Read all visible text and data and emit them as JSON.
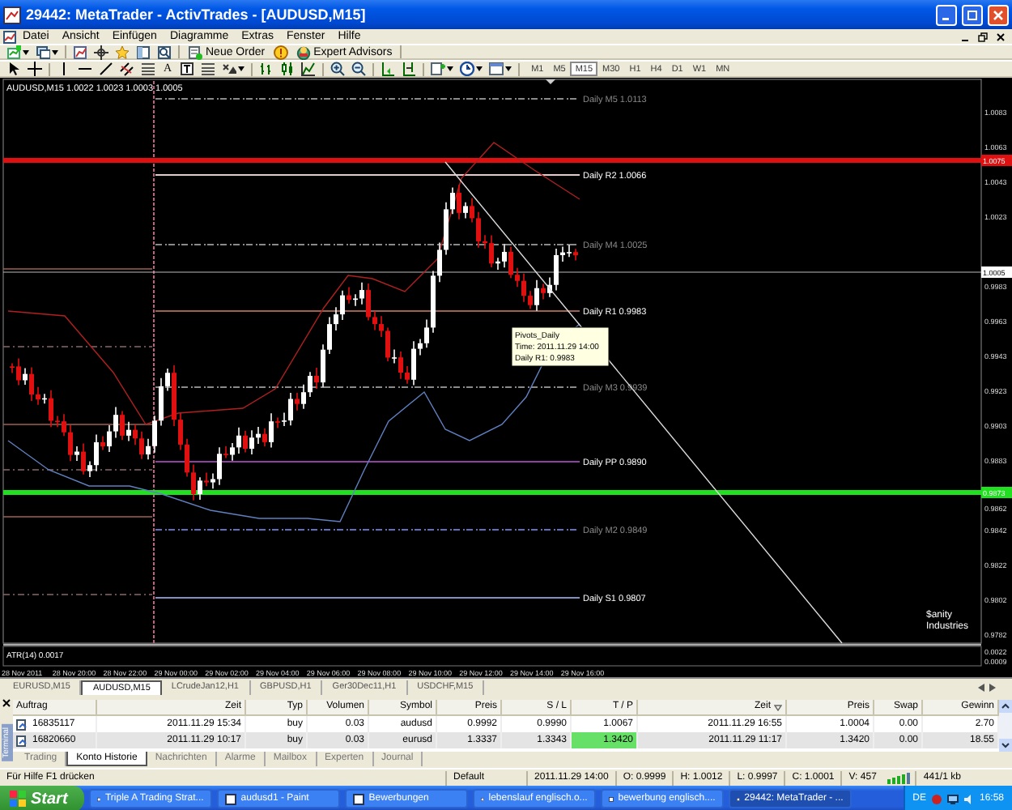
{
  "window": {
    "title": "29442: MetaTrader - ActivTrades - [AUDUSD,M15]"
  },
  "menu": [
    "Datei",
    "Ansicht",
    "Einfügen",
    "Diagramme",
    "Extras",
    "Fenster",
    "Hilfe"
  ],
  "toolbar": {
    "order_button": "Neue Order",
    "expert_button": "Expert Advisors",
    "text_tool": "A",
    "timeframes": [
      {
        "label": "M1",
        "selected": false
      },
      {
        "label": "M5",
        "selected": false
      },
      {
        "label": "M15",
        "selected": true
      },
      {
        "label": "M30",
        "selected": false
      },
      {
        "label": "H1",
        "selected": false
      },
      {
        "label": "H4",
        "selected": false
      },
      {
        "label": "D1",
        "selected": false
      },
      {
        "label": "W1",
        "selected": false
      },
      {
        "label": "MN",
        "selected": false
      }
    ]
  },
  "chart": {
    "header": "AUDUSD,M15 1.0022 1.0023 1.0003 1.0005",
    "price_axis": [
      "1.0083",
      "1.0063",
      "1.0043",
      "1.0023",
      "0.9983",
      "0.9963",
      "0.9943",
      "0.9923",
      "0.9903",
      "0.9883",
      "0.9862",
      "0.9842",
      "0.9822",
      "0.9802",
      "0.9782"
    ],
    "price_markers": [
      {
        "label": "1.0075",
        "color": "#e01010"
      },
      {
        "label": "1.0005",
        "color": "#ffffff"
      },
      {
        "label": "0.9873",
        "color": "#20e020"
      }
    ],
    "pivots": [
      {
        "label": "Daily M5 1.0113",
        "kind": "mid",
        "color": "#8a8a8a"
      },
      {
        "label": "Daily R2 1.0066",
        "kind": "main",
        "color": "#e8c8c8"
      },
      {
        "label": "Daily M4 1.0025",
        "kind": "mid",
        "color": "#8a8a8a"
      },
      {
        "label": "Daily R1 0.9983",
        "kind": "main",
        "color": "#a06050"
      },
      {
        "label": "Daily M3 0.9939",
        "kind": "mid",
        "color": "#8a8a8a"
      },
      {
        "label": "Daily PP 0.9890",
        "kind": "main",
        "color": "#9040a0"
      },
      {
        "label": "Daily M2 0.9849",
        "kind": "mid",
        "color": "#6070c0"
      },
      {
        "label": "Daily S1 0.9807",
        "kind": "main",
        "color": "#8090c0"
      }
    ],
    "tooltip": [
      "Pivots_Daily",
      "Time: 2011.11.29 14:00",
      "Daily R1: 0.9983"
    ],
    "logo": [
      "$anity",
      "Industries"
    ],
    "indicator": {
      "label": "ATR(14) 0.0017",
      "axis": [
        "0.0022",
        "0.0009"
      ]
    },
    "time_axis": [
      "28 Nov 2011",
      "28 Nov 20:00",
      "28 Nov 22:00",
      "29 Nov 00:00",
      "29 Nov 02:00",
      "29 Nov 04:00",
      "29 Nov 06:00",
      "29 Nov 08:00",
      "29 Nov 10:00",
      "29 Nov 12:00",
      "29 Nov 14:00",
      "29 Nov 16:00"
    ]
  },
  "chart_tabs": [
    {
      "label": "EURUSD,M15",
      "selected": false
    },
    {
      "label": "AUDUSD,M15",
      "selected": true
    },
    {
      "label": "LCrudeJan12,H1",
      "selected": false
    },
    {
      "label": "GBPUSD,H1",
      "selected": false
    },
    {
      "label": "Ger30Dec11,H1",
      "selected": false
    },
    {
      "label": "USDCHF,M15",
      "selected": false
    }
  ],
  "terminal": {
    "side_label": "Terminal",
    "columns": [
      "Auftrag",
      "Zeit",
      "Typ",
      "Volumen",
      "Symbol",
      "Preis",
      "S / L",
      "T / P",
      "Zeit",
      "Preis",
      "Swap",
      "Gewinn"
    ],
    "rows": [
      {
        "cells": [
          "16835117",
          "2011.11.29 15:34",
          "buy",
          "0.03",
          "audusd",
          "0.9992",
          "0.9990",
          "1.0067",
          "2011.11.29 16:55",
          "1.0004",
          "0.00",
          "2.70"
        ],
        "selected": false,
        "tp_highlight": false
      },
      {
        "cells": [
          "16820660",
          "2011.11.29 10:17",
          "buy",
          "0.03",
          "eurusd",
          "1.3337",
          "1.3343",
          "1.3420",
          "2011.11.29 11:17",
          "1.3420",
          "0.00",
          "18.55"
        ],
        "selected": true,
        "tp_highlight": true
      }
    ],
    "tabs": [
      {
        "label": "Trading",
        "selected": false
      },
      {
        "label": "Konto Historie",
        "selected": true
      },
      {
        "label": "Nachrichten",
        "selected": false
      },
      {
        "label": "Alarme",
        "selected": false
      },
      {
        "label": "Mailbox",
        "selected": false
      },
      {
        "label": "Experten",
        "selected": false
      },
      {
        "label": "Journal",
        "selected": false
      }
    ]
  },
  "status_bar": {
    "help": "Für Hilfe F1 drücken",
    "profile": "Default",
    "time": "2011.11.29 14:00",
    "open": "O: 0.9999",
    "high": "H: 1.0012",
    "low": "L: 0.9997",
    "close": "C: 1.0001",
    "volume": "V: 457",
    "traffic": "441/1 kb"
  },
  "taskbar": {
    "start": "Start",
    "tasks": [
      {
        "label": "Triple A Trading Strat...",
        "selected": false
      },
      {
        "label": "audusd1 - Paint",
        "selected": false
      },
      {
        "label": "Bewerbungen",
        "selected": false
      },
      {
        "label": "lebenslauf englisch.o...",
        "selected": false
      },
      {
        "label": "bewerbung englisch....",
        "selected": false
      },
      {
        "label": "29442: MetaTrader - ...",
        "selected": true
      }
    ],
    "language": "DE",
    "clock": "16:58"
  }
}
